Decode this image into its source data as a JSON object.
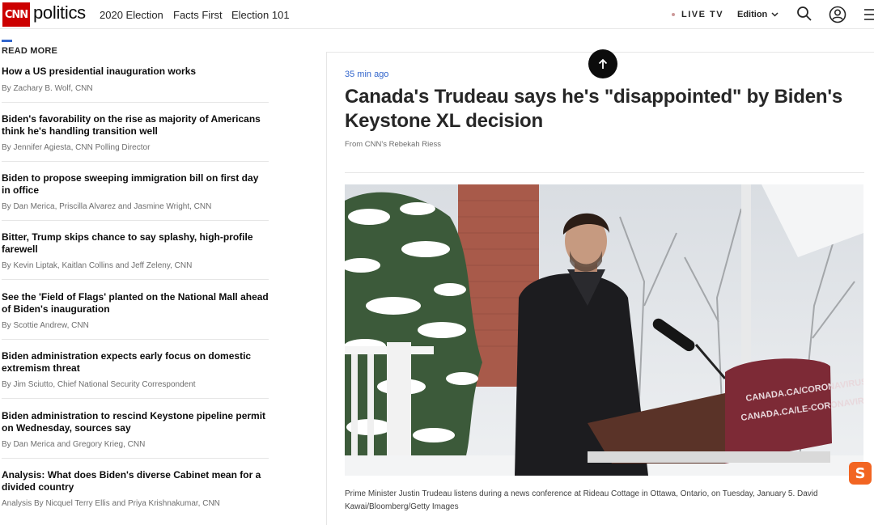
{
  "header": {
    "logo": "CNN",
    "section": "politics",
    "nav": [
      "2020 Election",
      "Facts First",
      "Election 101"
    ],
    "live_tv": "LIVE TV",
    "edition": "Edition"
  },
  "read_more": {
    "label": "READ MORE",
    "stories": [
      {
        "title": "How a US presidential inauguration works",
        "byline": "By Zachary B. Wolf, CNN"
      },
      {
        "title": "Biden's favorability on the rise as majority of Americans think he's handling transition well",
        "byline": "By Jennifer Agiesta, CNN Polling Director"
      },
      {
        "title": "Biden to propose sweeping immigration bill on first day in office",
        "byline": "By Dan Merica, Priscilla Alvarez and Jasmine Wright, CNN"
      },
      {
        "title": "Bitter, Trump skips chance to say splashy, high-profile farewell",
        "byline": "By Kevin Liptak, Kaitlan Collins and Jeff Zeleny, CNN"
      },
      {
        "title": "See the 'Field of Flags' planted on the National Mall ahead of Biden's inauguration",
        "byline": "By Scottie Andrew, CNN"
      },
      {
        "title": "Biden administration expects early focus on domestic extremism threat",
        "byline": "By Jim Sciutto, Chief National Security Correspondent"
      },
      {
        "title": "Biden administration to rescind Keystone pipeline permit on Wednesday, sources say",
        "byline": "By Dan Merica and Gregory Krieg, CNN"
      },
      {
        "title": "Analysis: What does Biden's diverse Cabinet mean for a divided country",
        "byline": "Analysis By Nicquel Terry Ellis and Priya Krishnakumar, CNN"
      }
    ]
  },
  "article": {
    "timestamp": "35 min ago",
    "headline": "Canada's Trudeau says he's \"disappointed\" by Biden's Keystone XL decision",
    "source": "From CNN's Rebekah Riess",
    "photo": {
      "podium_line1": "CANADA.CA/CORONAVIRUS",
      "podium_line2": "CANADA.CA/LE-CORONAVIRUS"
    },
    "caption": "Prime Minister Justin Trudeau listens during a news conference at Rideau Cottage in Ottawa, Ontario, on Tuesday, January 5. David Kawai/Bloomberg/Getty Images"
  },
  "colors": {
    "brand_red": "#cc0000",
    "link_blue": "#3366cc",
    "badge_orange": "#f26522"
  },
  "icons": [
    "arrow-up-icon",
    "search-icon",
    "account-icon",
    "menu-icon",
    "chevron-down-icon",
    "s-badge-icon"
  ]
}
